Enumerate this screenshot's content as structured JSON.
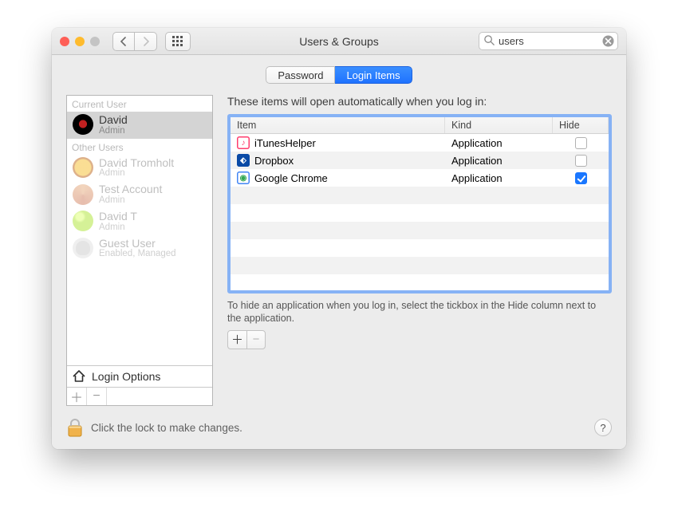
{
  "window": {
    "title": "Users & Groups",
    "search_value": "users"
  },
  "tabs": {
    "password": "Password",
    "login_items": "Login Items"
  },
  "sidebar": {
    "current_label": "Current User",
    "other_label": "Other Users",
    "login_options": "Login Options",
    "users": [
      {
        "name": "David",
        "sub": "Admin",
        "avatar": "red",
        "selected": true,
        "active": true
      },
      {
        "name": "David Tromholt",
        "sub": "Admin",
        "avatar": "sun",
        "selected": false,
        "active": false
      },
      {
        "name": "Test Account",
        "sub": "Admin",
        "avatar": "orb",
        "selected": false,
        "active": false
      },
      {
        "name": "David T",
        "sub": "Admin",
        "avatar": "grn",
        "selected": false,
        "active": false
      },
      {
        "name": "Guest User",
        "sub": "Enabled, Managed",
        "avatar": "ghost",
        "selected": false,
        "active": false
      }
    ]
  },
  "main": {
    "description": "These items will open automatically when you log in:",
    "columns": {
      "item": "Item",
      "kind": "Kind",
      "hide": "Hide"
    },
    "rows": [
      {
        "name": "iTunesHelper",
        "kind": "Application",
        "hide": false,
        "icon": "itunes"
      },
      {
        "name": "Dropbox",
        "kind": "Application",
        "hide": false,
        "icon": "dropbox"
      },
      {
        "name": "Google Chrome",
        "kind": "Application",
        "hide": true,
        "icon": "chrome"
      }
    ],
    "hint": "To hide an application when you log in, select the tickbox in the Hide column next to the application."
  },
  "footer": {
    "lock_message": "Click the lock to make changes.",
    "help_glyph": "?"
  },
  "glyphs": {
    "plus": "＋",
    "minus": "−"
  },
  "icons": {
    "itunes": {
      "bg": "#ffffff",
      "ring": "#ff3d6e",
      "glyph": "♪",
      "fg": "#ff3d6e"
    },
    "dropbox": {
      "bg": "#0a4aa6",
      "ring": "#0a4aa6",
      "glyph": "⬖",
      "fg": "#ffffff"
    },
    "chrome": {
      "bg": "#ffffff",
      "ring": "#4285f4",
      "glyph": "◉",
      "fg": "#34a853"
    }
  }
}
